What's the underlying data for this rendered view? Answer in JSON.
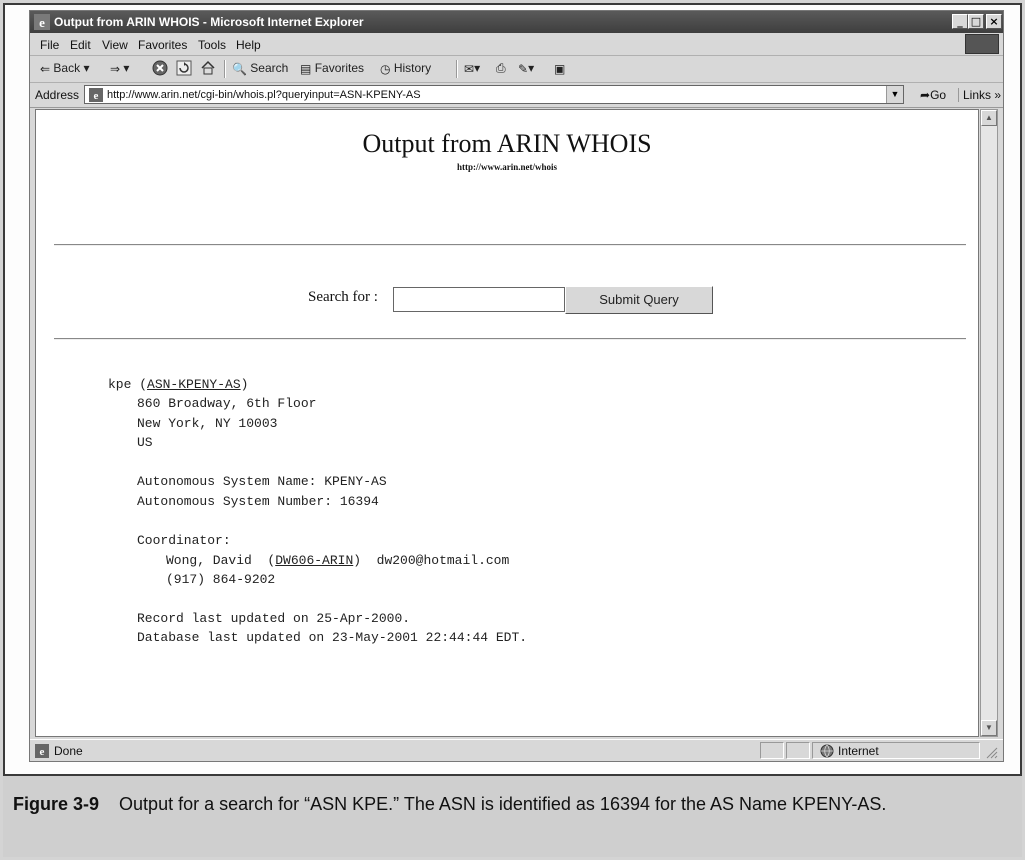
{
  "window": {
    "title": "Output from ARIN WHOIS - Microsoft Internet Explorer",
    "controls": {
      "minimize": "_",
      "maximize": "□",
      "close": "×"
    }
  },
  "menu": [
    "File",
    "Edit",
    "View",
    "Favorites",
    "Tools",
    "Help"
  ],
  "toolbar": {
    "back": "Back",
    "search": "Search",
    "favorites": "Favorites",
    "history": "History"
  },
  "address": {
    "label": "Address",
    "url": "http://www.arin.net/cgi-bin/whois.pl?queryinput=ASN-KPENY-AS",
    "go": "Go",
    "links": "Links"
  },
  "page": {
    "heading": "Output from ARIN WHOIS",
    "subheading": "http://www.arin.net/whois",
    "search_label": "Search for :",
    "search_value": "",
    "submit_label": "Submit Query"
  },
  "whois": {
    "org_name": "kpe",
    "handle": "ASN-KPENY-AS",
    "street": "860 Broadway, 6th Floor",
    "city": "New York, NY 10003",
    "country": "US",
    "as_name": "Autonomous System Name: KPENY-AS",
    "as_number": "Autonomous System Number: 16394",
    "coordinator_label": "Coordinator:",
    "coordinator_name": "Wong, David",
    "coordinator_handle": "DW606-ARIN",
    "coordinator_email": "dw200@hotmail.com",
    "coordinator_phone": "(917) 864-9202",
    "record_updated": "Record last updated on 25-Apr-2000.",
    "database_updated": "Database last updated on 23-May-2001 22:44:44 EDT."
  },
  "status": {
    "text": "Done",
    "zone": "Internet"
  },
  "caption": {
    "label": "Figure 3-9",
    "text": "Output for a search for “ASN KPE.” The ASN is identified as 16394 for the AS Name KPENY-AS."
  }
}
